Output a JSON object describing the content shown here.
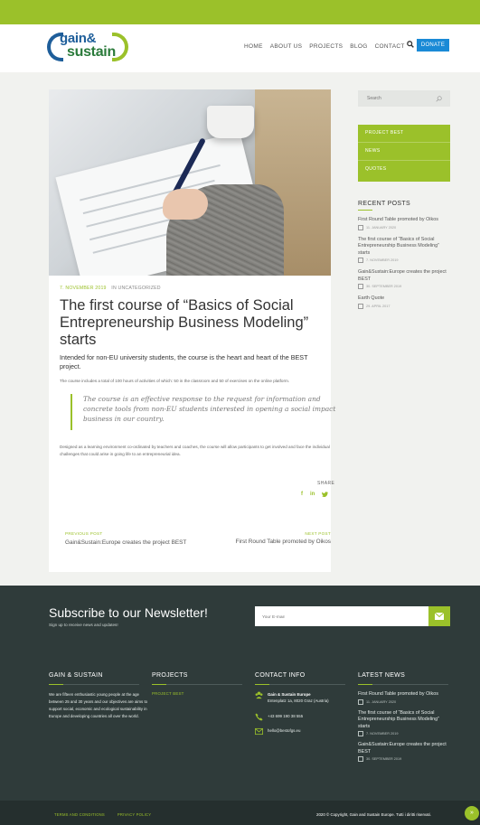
{
  "brand": {
    "logo_line1": "gain&",
    "logo_line2": "sustain",
    "accent_green": "#9bc12a",
    "accent_blue": "#1a8ad6",
    "footer_bg": "#2f3b3a"
  },
  "nav": {
    "items": [
      "HOME",
      "ABOUT US",
      "PROJECTS",
      "BLOG",
      "CONTACT"
    ],
    "donate_label": "DONATE",
    "search_icon": "search-icon"
  },
  "article": {
    "date": "7. NOVEMBER 2019",
    "category": "IN UNCATEGORIZED",
    "title": "The first course of “Basics of Social Entrepreneurship Business Modeling” starts",
    "lead": "Intended for non-EU university students, the course is the heart and heart of the BEST project.",
    "small": "The course includes a total of 100 hours of activities of which: 50 in the classroom and 50 of exercises on the online platform.",
    "quote": "The course is an effective response to the request for information and concrete tools from non-EU students interested in opening a social impact business in our country.",
    "body": "Designed as a learning environment co-ordinated by teachers and coaches, the course will allow participants to get involved and face the individual challenges that could arise in going life to an entrepreneurial idea.",
    "share_label": "SHARE",
    "share_icons": [
      "f",
      "in",
      "t"
    ],
    "prev_label": "PREVIOUS POST",
    "prev_title": "Gain&Sustain:Europe creates the project BEST",
    "next_label": "NEXT POST",
    "next_title": "First Round Table promoted by Oikos"
  },
  "sidebar": {
    "search_placeholder": "Search",
    "menu": [
      "PROJECT BEST",
      "NEWS",
      "QUOTES"
    ],
    "recent_title": "RECENT POSTS",
    "recent": [
      {
        "title": "First Round Table promoted by Oikos",
        "date": "11. JANUARY 2020"
      },
      {
        "title": "The first course of “Basics of Social Entrepreneurship Business Modeling” starts",
        "date": "7. NOVEMBER 2019"
      },
      {
        "title": "Gain&Sustain:Europe creates the project BEST",
        "date": "30. SEPTEMBER 2019"
      },
      {
        "title": "Earth Quote",
        "date": "29. APRIL 2017"
      }
    ]
  },
  "newsletter": {
    "title": "Subscribe to our Newsletter!",
    "subtitle": "Sign up to receive news and updates!",
    "placeholder": "Your E-mail"
  },
  "footer": {
    "col1_title": "GAIN & SUSTAIN",
    "about": "We are fifteen enthusiastic young people at the age between 25 and 30 years and our objectives are aims to support social, economic and ecological sustainability in Europe and developing countries all over the world.",
    "col2_title": "PROJECTS",
    "project_link": "PROJECT BEST",
    "col3_title": "CONTACT INFO",
    "org_name": "Gain & Sustain Europe",
    "address": "Entenplatz 1a, 8020 Graz (Austria)",
    "phone": "+43 699 190 38 555",
    "email": "hello@bestofgs.eu",
    "col4_title": "LATEST NEWS",
    "latest": [
      {
        "title": "First Round Table promoted by Oikos",
        "date": "11. JANUARY 2020"
      },
      {
        "title": "The first course of “Basics of Social Entrepreneurship Business Modeling” starts",
        "date": "7. NOVEMBER 2019"
      },
      {
        "title": "Gain&Sustain:Europe creates the project BEST",
        "date": "30. SEPTEMBER 2019"
      }
    ]
  },
  "bottom": {
    "terms": "TERMS AND CONDITIONS",
    "privacy": "PRIVACY POLICY",
    "copyright": "2020 © Copyright, Gain and Sustain Europe. Tutti i diritti riservati.",
    "totop": "»"
  }
}
